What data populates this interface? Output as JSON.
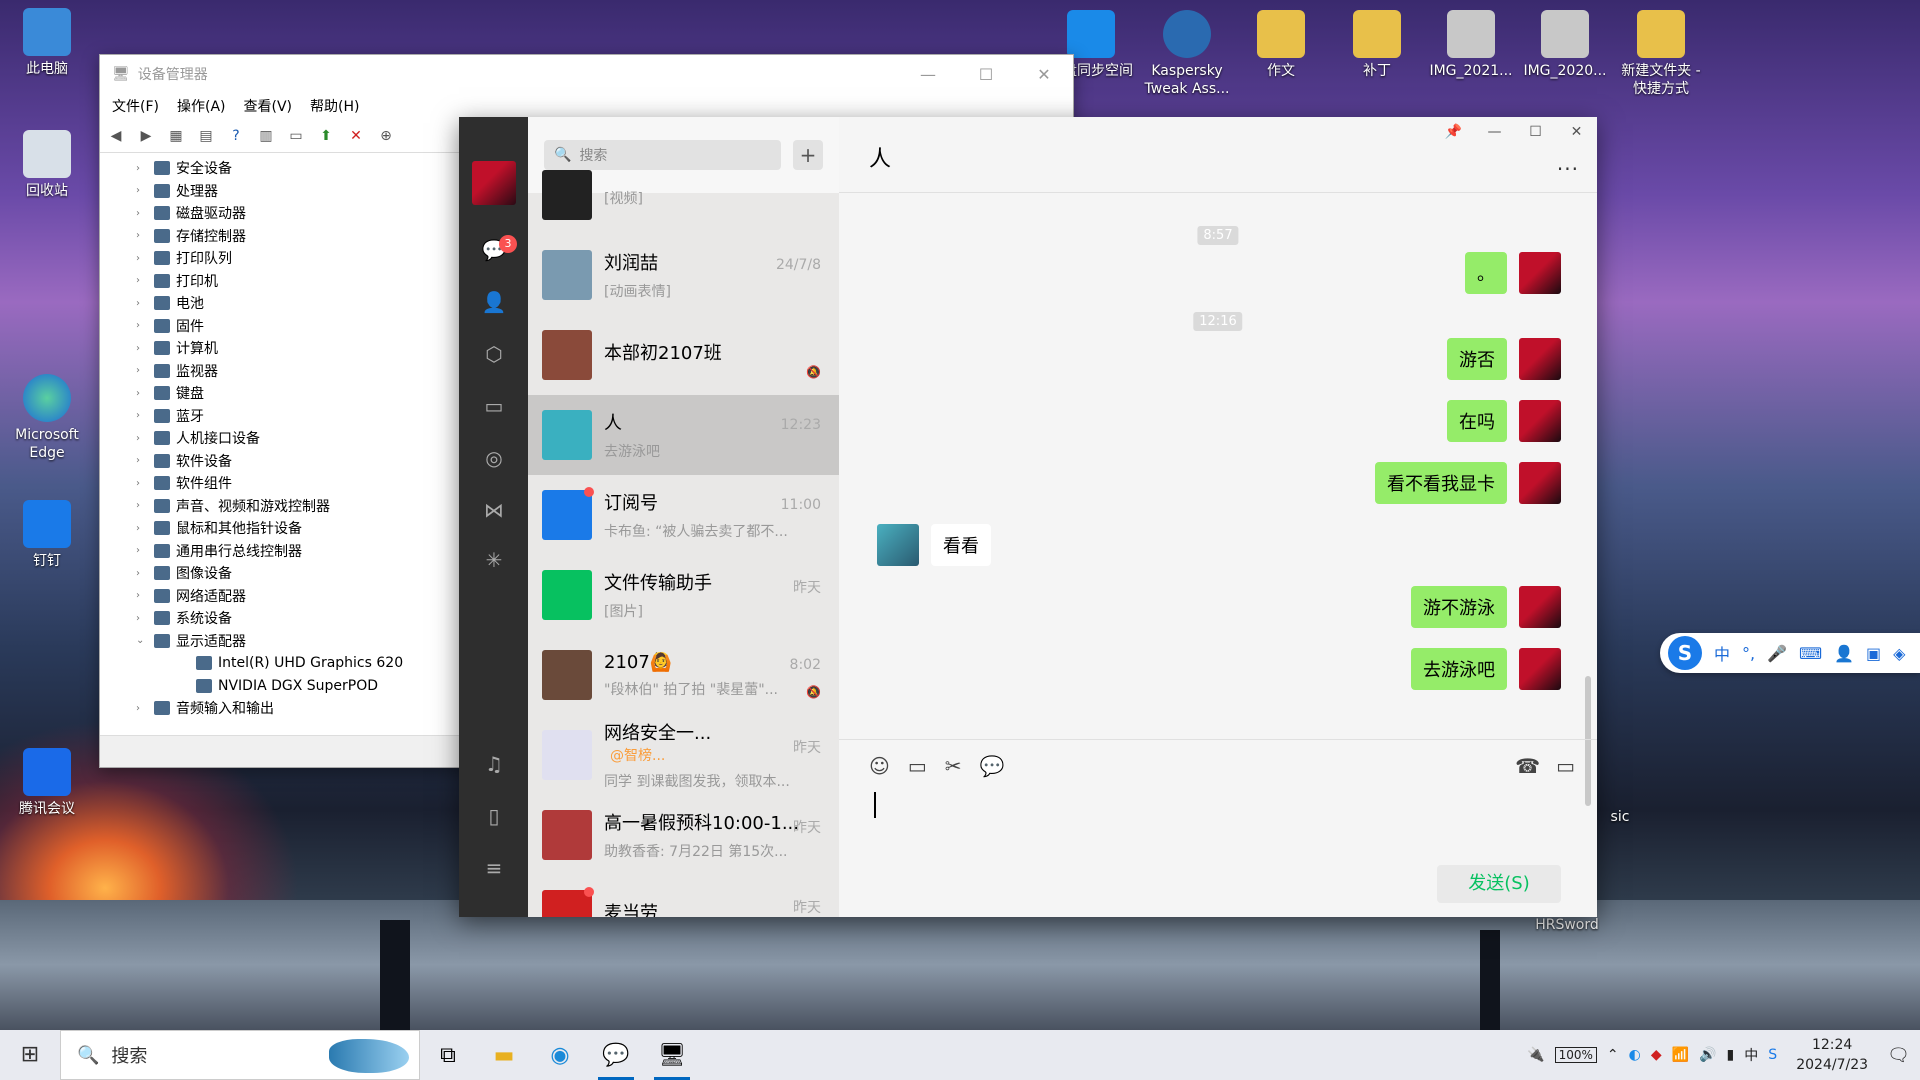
{
  "desktop": {
    "icons": [
      {
        "label": "此电脑",
        "color": "#3a8ad8"
      },
      {
        "label": "回收站",
        "color": "#d8e0e8"
      },
      {
        "label": "Microsoft Edge",
        "color": "#1a8ad8"
      },
      {
        "label": "钉钉",
        "color": "#1a7ae8"
      },
      {
        "label": "腾讯会议",
        "color": "#1a6ae8"
      },
      {
        "label": "网盘同步空间",
        "color": "#1a8ae8"
      },
      {
        "label": "Kaspersky Tweak Ass...",
        "color": "#2a6ab0"
      },
      {
        "label": "作文",
        "color": "#e8c04a"
      },
      {
        "label": "补丁",
        "color": "#e8c04a"
      },
      {
        "label": "IMG_2021...",
        "color": "#c8c8c8"
      },
      {
        "label": "IMG_2020...",
        "color": "#c8c8c8"
      },
      {
        "label": "新建文件夹 - 快捷方式",
        "color": "#e8c04a"
      },
      {
        "label": "HRSword",
        "color": "#3a6ab0"
      },
      {
        "label": "sic",
        "color": "#888888"
      }
    ]
  },
  "devmgr": {
    "title": "设备管理器",
    "menu": [
      "文件(F)",
      "操作(A)",
      "查看(V)",
      "帮助(H)"
    ],
    "tree": [
      {
        "label": "安全设备"
      },
      {
        "label": "处理器"
      },
      {
        "label": "磁盘驱动器"
      },
      {
        "label": "存储控制器"
      },
      {
        "label": "打印队列"
      },
      {
        "label": "打印机"
      },
      {
        "label": "电池"
      },
      {
        "label": "固件"
      },
      {
        "label": "计算机"
      },
      {
        "label": "监视器"
      },
      {
        "label": "键盘"
      },
      {
        "label": "蓝牙"
      },
      {
        "label": "人机接口设备"
      },
      {
        "label": "软件设备"
      },
      {
        "label": "软件组件"
      },
      {
        "label": "声音、视频和游戏控制器"
      },
      {
        "label": "鼠标和其他指针设备"
      },
      {
        "label": "通用串行总线控制器"
      },
      {
        "label": "图像设备"
      },
      {
        "label": "网络适配器"
      },
      {
        "label": "系统设备"
      },
      {
        "label": "显示适配器",
        "expanded": true
      },
      {
        "label": "Intel(R) UHD Graphics 620",
        "child": true
      },
      {
        "label": "NVIDIA DGX SuperPOD",
        "child": true
      },
      {
        "label": "音频输入和输出"
      }
    ]
  },
  "wechat": {
    "unread_badge": "3",
    "search_placeholder": "搜索",
    "chats": [
      {
        "name": "",
        "preview": "[视频]",
        "time": ""
      },
      {
        "name": "刘润喆",
        "preview": "[动画表情]",
        "time": "24/7/8"
      },
      {
        "name": "本部初2107班",
        "preview": "",
        "time": "",
        "muted": true
      },
      {
        "name": "人",
        "preview": "去游泳吧",
        "time": "12:23",
        "active": true
      },
      {
        "name": "订阅号",
        "preview": "卡布鱼: “被人骗去卖了都不...",
        "time": "11:00",
        "dot": true
      },
      {
        "name": "文件传输助手",
        "preview": "[图片]",
        "time": "昨天"
      },
      {
        "name": "2107🙆",
        "preview": "\"段林伯\" 拍了拍 \"裴星蕾\"...",
        "time": "8:02",
        "muted": true
      },
      {
        "name": "网络安全一...",
        "mention": "@智榜...",
        "preview": "同学  到课截图发我，领取本...",
        "time": "昨天"
      },
      {
        "name": "高一暑假预科10:00-1...",
        "preview": "助教香香: 7月22日   第15次...",
        "time": "昨天"
      },
      {
        "name": "麦当劳",
        "preview": "",
        "time": "昨天",
        "dot": true
      }
    ],
    "chat_title": "人",
    "timestamps": [
      "8:57",
      "12:16"
    ],
    "messages": [
      {
        "side": "right",
        "text": "。"
      },
      {
        "side": "right",
        "text": "游否"
      },
      {
        "side": "right",
        "text": "在吗"
      },
      {
        "side": "right",
        "text": "看不看我显卡"
      },
      {
        "side": "left",
        "text": "看看"
      },
      {
        "side": "right",
        "text": "游不游泳"
      },
      {
        "side": "right",
        "text": "去游泳吧"
      }
    ],
    "send_label": "发送(S)"
  },
  "ime": {
    "logo": "S",
    "mode": "中"
  },
  "taskbar": {
    "search_label": "搜索",
    "battery": "100%",
    "time": "12:24",
    "date": "2024/7/23",
    "ime_lang": "中"
  }
}
